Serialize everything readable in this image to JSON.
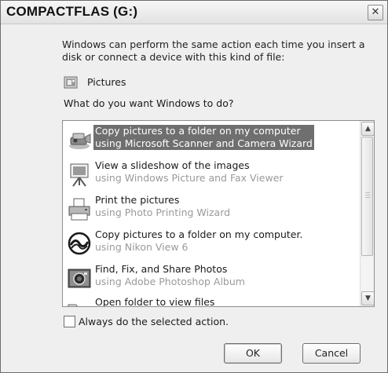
{
  "window": {
    "title": "COMPACTFLAS (G:)",
    "close_glyph": "✕"
  },
  "description": "Windows can perform the same action each time you insert a disk or connect a device with this kind of file:",
  "content_type": {
    "icon": "pictures-icon",
    "label": "Pictures"
  },
  "prompt": "What do you want Windows to do?",
  "actions": [
    {
      "line1": "Copy pictures to a folder on my computer",
      "line2": "using Microsoft Scanner and Camera Wizard",
      "icon": "scanner-camera-icon",
      "selected": true
    },
    {
      "line1": "View a slideshow of the images",
      "line2": "using Windows Picture and Fax Viewer",
      "icon": "slideshow-easel-icon",
      "selected": false
    },
    {
      "line1": "Print the pictures",
      "line2": "using Photo Printing Wizard",
      "icon": "printer-icon",
      "selected": false
    },
    {
      "line1": "Copy pictures to a folder on my computer.",
      "line2": "using Nikon View 6",
      "icon": "nikon-view-icon",
      "selected": false
    },
    {
      "line1": "Find, Fix, and Share Photos",
      "line2": "using Adobe Photoshop Album",
      "icon": "photo-camera-icon",
      "selected": false
    },
    {
      "line1": "Open folder to view files",
      "line2": "",
      "icon": "folder-icon",
      "selected": false
    }
  ],
  "scrollbar": {
    "up_glyph": "▲",
    "down_glyph": "▼"
  },
  "always_checkbox": {
    "label": "Always do the selected action.",
    "checked": false
  },
  "buttons": {
    "ok": "OK",
    "cancel": "Cancel"
  },
  "colors": {
    "selection": "#6f6f6f",
    "secondary_text": "#9a9a9a",
    "dialog_bg": "#efefef"
  }
}
